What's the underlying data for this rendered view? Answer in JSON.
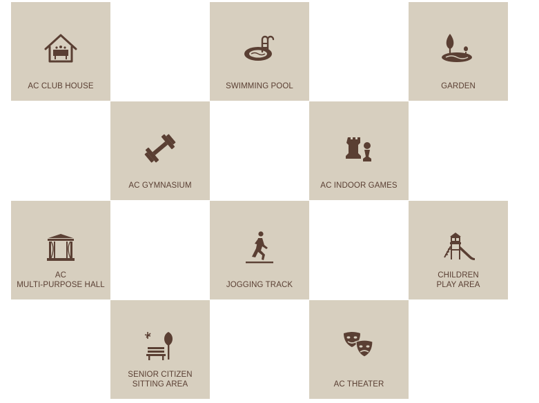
{
  "amenities": [
    {
      "label": "AC CLUB HOUSE",
      "icon": "club-house-icon"
    },
    {
      "label": "SWIMMING POOL",
      "icon": "swimming-pool-icon"
    },
    {
      "label": "GARDEN",
      "icon": "garden-icon"
    },
    {
      "label": "AC GYMNASIUM",
      "icon": "dumbbell-icon"
    },
    {
      "label": "AC INDOOR GAMES",
      "icon": "chess-icon"
    },
    {
      "label": "AC\nMULTI-PURPOSE HALL",
      "icon": "stage-hall-icon"
    },
    {
      "label": "JOGGING TRACK",
      "icon": "jogger-icon"
    },
    {
      "label": "CHILDREN\nPLAY AREA",
      "icon": "playground-slide-icon"
    },
    {
      "label": "SENIOR CITIZEN\nSITTING AREA",
      "icon": "bench-tree-icon"
    },
    {
      "label": "AC THEATER",
      "icon": "theater-masks-icon"
    }
  ],
  "colors": {
    "tile_background": "#d7cfbf",
    "icon_and_text": "#5a3f33",
    "page_background": "#ffffff"
  }
}
